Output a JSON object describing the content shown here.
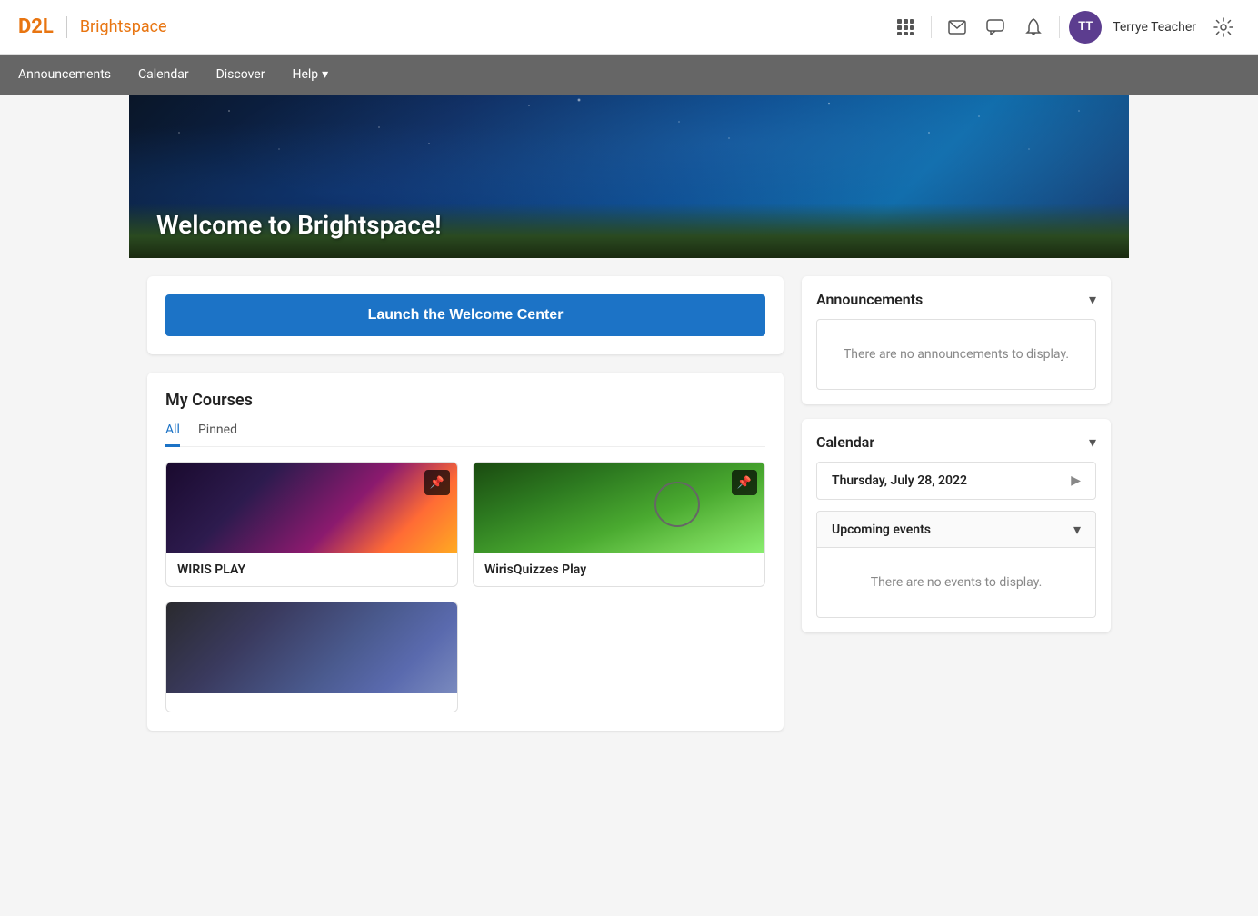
{
  "header": {
    "logo_d2l": "D2L",
    "logo_brightspace": "Brightspace",
    "user_initials": "TT",
    "user_name": "Terrye Teacher"
  },
  "navbar": {
    "items": [
      {
        "label": "Announcements"
      },
      {
        "label": "Calendar"
      },
      {
        "label": "Discover"
      },
      {
        "label": "Help"
      }
    ]
  },
  "hero": {
    "title": "Welcome to Brightspace!"
  },
  "welcome_card": {
    "launch_button": "Launch the Welcome Center"
  },
  "my_courses": {
    "title": "My Courses",
    "tabs": [
      {
        "label": "All",
        "active": true
      },
      {
        "label": "Pinned"
      }
    ],
    "courses": [
      {
        "name": "WIRIS PLAY",
        "image": "1"
      },
      {
        "name": "WirisQuizzes Play",
        "image": "2"
      },
      {
        "name": "",
        "image": "3"
      }
    ]
  },
  "announcements": {
    "title": "Announcements",
    "empty_message": "There are no announcements to display."
  },
  "calendar": {
    "title": "Calendar",
    "date": "Thursday, July 28, 2022",
    "upcoming_events": {
      "title": "Upcoming events",
      "empty_message": "There are no events to display."
    }
  }
}
